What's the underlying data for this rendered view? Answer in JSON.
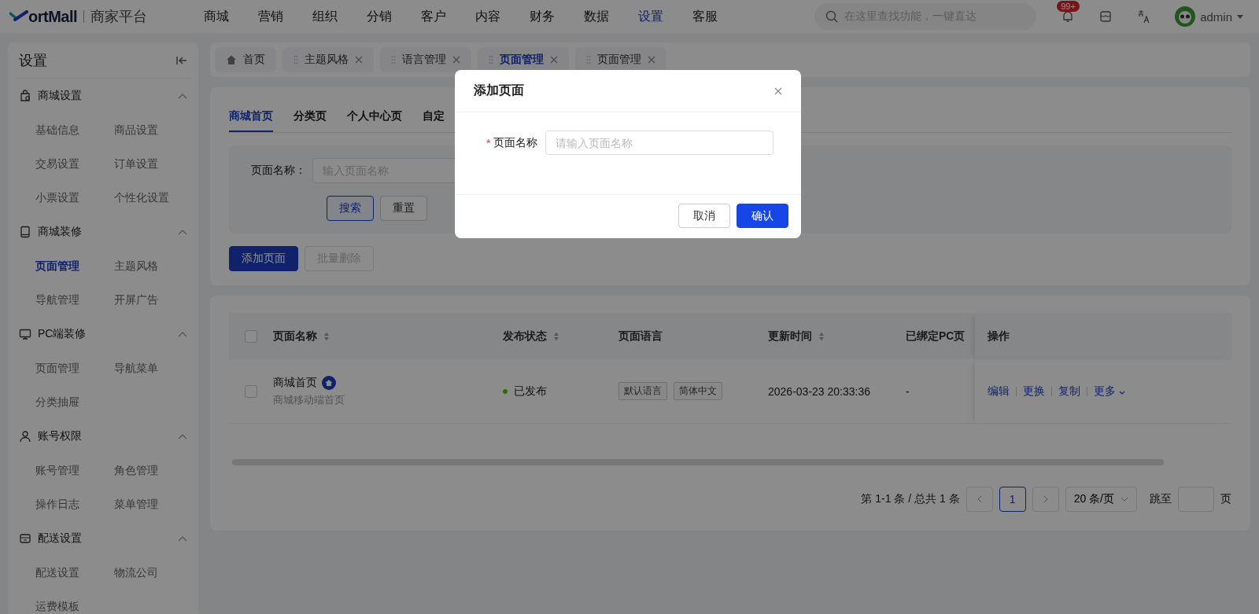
{
  "header": {
    "logo": "ortMall",
    "subtitle": "商家平台",
    "nav": [
      {
        "label": "商城",
        "selected": false
      },
      {
        "label": "营销",
        "selected": false
      },
      {
        "label": "组织",
        "selected": false
      },
      {
        "label": "分销",
        "selected": false
      },
      {
        "label": "客户",
        "selected": false
      },
      {
        "label": "内容",
        "selected": false
      },
      {
        "label": "财务",
        "selected": false
      },
      {
        "label": "数据",
        "selected": false
      },
      {
        "label": "设置",
        "selected": true
      },
      {
        "label": "客服",
        "selected": false
      }
    ],
    "search": {
      "placeholder": "在这里查找功能，一键直达"
    },
    "notification_badge": "99+",
    "user": "admin"
  },
  "sidebar": {
    "title": "设置",
    "groups": [
      {
        "label": "商城设置",
        "expanded": true,
        "items": [
          {
            "label": "基础信息",
            "selected": false
          },
          {
            "label": "商品设置",
            "selected": false
          },
          {
            "label": "交易设置",
            "selected": false
          },
          {
            "label": "订单设置",
            "selected": false
          },
          {
            "label": "小票设置",
            "selected": false
          },
          {
            "label": "个性化设置",
            "selected": false
          }
        ]
      },
      {
        "label": "商城装修",
        "expanded": true,
        "items": [
          {
            "label": "页面管理",
            "selected": true
          },
          {
            "label": "主题风格",
            "selected": false
          },
          {
            "label": "导航管理",
            "selected": false
          },
          {
            "label": "开屏广告",
            "selected": false
          }
        ]
      },
      {
        "label": "PC端装修",
        "expanded": true,
        "items": [
          {
            "label": "页面管理",
            "selected": false
          },
          {
            "label": "导航菜单",
            "selected": false
          },
          {
            "label": "分类抽屉",
            "selected": false
          }
        ]
      },
      {
        "label": "账号权限",
        "expanded": true,
        "items": [
          {
            "label": "账号管理",
            "selected": false
          },
          {
            "label": "角色管理",
            "selected": false
          },
          {
            "label": "操作日志",
            "selected": false
          },
          {
            "label": "菜单管理",
            "selected": false
          }
        ]
      },
      {
        "label": "配送设置",
        "expanded": true,
        "items": [
          {
            "label": "配送设置",
            "selected": false
          },
          {
            "label": "物流公司",
            "selected": false
          },
          {
            "label": "运费模板",
            "selected": false
          }
        ]
      }
    ]
  },
  "page_tabs": [
    {
      "label": "首页",
      "kind": "home",
      "selected": false
    },
    {
      "label": "主题风格",
      "kind": "page",
      "selected": false
    },
    {
      "label": "语言管理",
      "kind": "page",
      "selected": false
    },
    {
      "label": "页面管理",
      "kind": "page",
      "selected": true
    },
    {
      "label": "页面管理",
      "kind": "page",
      "selected": false
    }
  ],
  "sub_tabs": [
    {
      "label": "商城首页",
      "selected": true
    },
    {
      "label": "分类页",
      "selected": false
    },
    {
      "label": "个人中心页",
      "selected": false
    },
    {
      "label": "自定",
      "selected": false
    }
  ],
  "filter": {
    "label": "页面名称：",
    "placeholder": "输入页面名称",
    "buttons": [
      {
        "label": "搜索",
        "kind": "outline"
      },
      {
        "label": "重置",
        "kind": "default"
      }
    ]
  },
  "actions": [
    {
      "label": "添加页面",
      "kind": "primary",
      "disabled": false
    },
    {
      "label": "批量删除",
      "kind": "default",
      "disabled": true
    }
  ],
  "table": {
    "select_all_checked": false,
    "columns": [
      {
        "label": "页面名称",
        "sortable": true
      },
      {
        "label": "发布状态",
        "sortable": true
      },
      {
        "label": "页面语言",
        "sortable": false
      },
      {
        "label": "更新时间",
        "sortable": true
      },
      {
        "label": "已绑定PC页",
        "sortable": false
      },
      {
        "label": "操作",
        "sortable": false
      }
    ],
    "rows": [
      {
        "checked": false,
        "name": "商城首页",
        "is_home": true,
        "subtitle": "商城移动端首页",
        "status": {
          "label": "已发布",
          "color": "#2d6c0e"
        },
        "languages": [
          "默认语言",
          "简体中文"
        ],
        "updated": "2026-03-23 20:33:36",
        "pc_page": "-",
        "actions": [
          "编辑",
          "更换",
          "复制",
          "更多"
        ]
      }
    ]
  },
  "pagination": {
    "summary": "第 1-1 条 / 总共 1 条",
    "pages": [
      {
        "label": "1",
        "selected": true
      }
    ],
    "page_size": "20 条/页",
    "jump_label": "跳至",
    "page_suffix": "页"
  },
  "modal": {
    "title": "添加页面",
    "field": {
      "label": "页面名称",
      "required": true,
      "required_mark": "*",
      "placeholder": "请输入页面名称"
    },
    "buttons": [
      {
        "label": "取消",
        "kind": "default"
      },
      {
        "label": "确认",
        "kind": "primary"
      }
    ]
  }
}
